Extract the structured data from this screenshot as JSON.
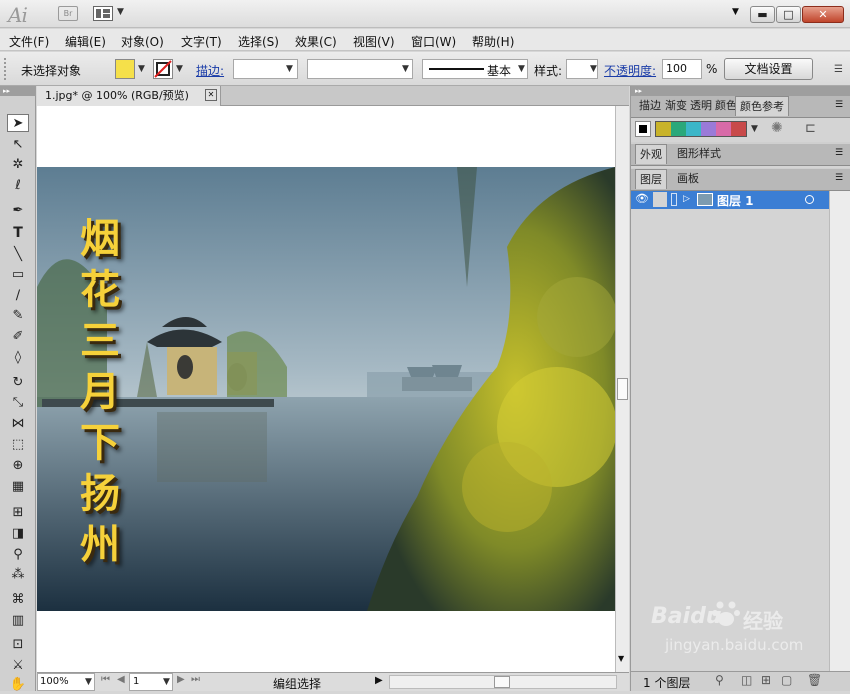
{
  "app": {
    "logo": "Ai",
    "bridge": "Br"
  },
  "window": {
    "minimize": "▬",
    "maximize": "□",
    "close": "✕",
    "workspace_arrow": "▼"
  },
  "menu": [
    "文件(F)",
    "编辑(E)",
    "对象(O)",
    "文字(T)",
    "选择(S)",
    "效果(C)",
    "视图(V)",
    "窗口(W)",
    "帮助(H)"
  ],
  "control": {
    "selection_status": "未选择对象",
    "fill_color": "#f5e04a",
    "stroke_label": "描边:",
    "stroke_style_label": "基本",
    "style_label": "样式:",
    "opacity_label": "不透明度:",
    "opacity_value": "100",
    "percent": "%",
    "doc_setup": "文档设置"
  },
  "document": {
    "tab_title": "1.jpg* @ 100% (RGB/预览)",
    "close": "✕",
    "poster_text": [
      "烟",
      "花",
      "三",
      "月",
      "下",
      "扬",
      "州"
    ],
    "text_color": "#f6d13a"
  },
  "status": {
    "zoom": "100%",
    "page": "1",
    "tool_label": "编组选择"
  },
  "panels": {
    "group1_tabs": [
      "描边",
      "渐变",
      "透明",
      "颜色",
      "颜色参考"
    ],
    "group2_tabs": [
      "外观",
      "图形样式"
    ],
    "group3_tabs": [
      "图层",
      "画板"
    ],
    "guide_colors": [
      "#c8b32a",
      "#2aa87a",
      "#3bb6c8",
      "#9a7ad8",
      "#d86aa8",
      "#c84a4a"
    ],
    "layer_name": "图层 1",
    "layer_count": "1 个图层"
  },
  "watermark": {
    "brand": "Baidu",
    "brand2": "经验",
    "url": "jingyan.baidu.com"
  }
}
